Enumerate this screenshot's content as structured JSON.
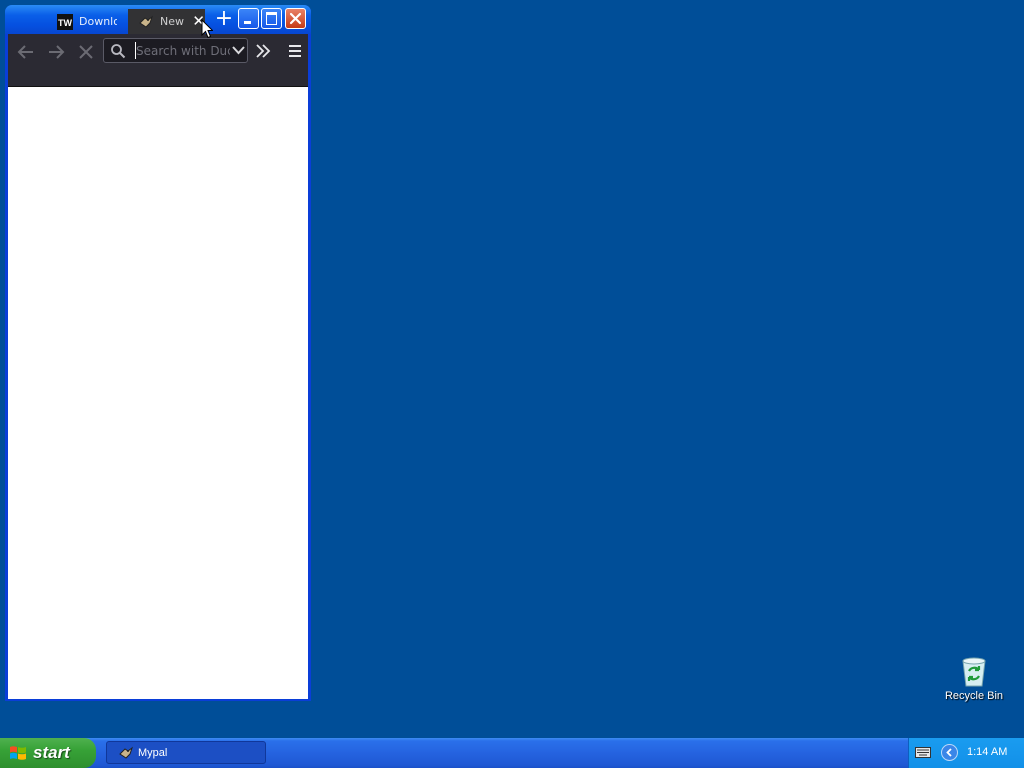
{
  "browser": {
    "tabs": [
      {
        "title": "Downlo",
        "favicon": "tw-favicon",
        "active": false
      },
      {
        "title": "New",
        "favicon": "mypal-favicon",
        "active": true
      }
    ],
    "search": {
      "placeholder": "Search with Duc"
    }
  },
  "desktop": {
    "icons": [
      {
        "label": "Recycle Bin",
        "icon": "recycle-bin-icon"
      }
    ]
  },
  "taskbar": {
    "start_label": "start",
    "tasks": [
      {
        "label": "Mypal",
        "icon": "mypal-icon"
      }
    ],
    "clock": "1:14 AM"
  },
  "colors": {
    "desktop_background": "#004e98",
    "window_frame": "#0a3ed8",
    "toolbar": "#2b2a33",
    "taskbar": "#245edb",
    "start_button": "#37a237"
  }
}
